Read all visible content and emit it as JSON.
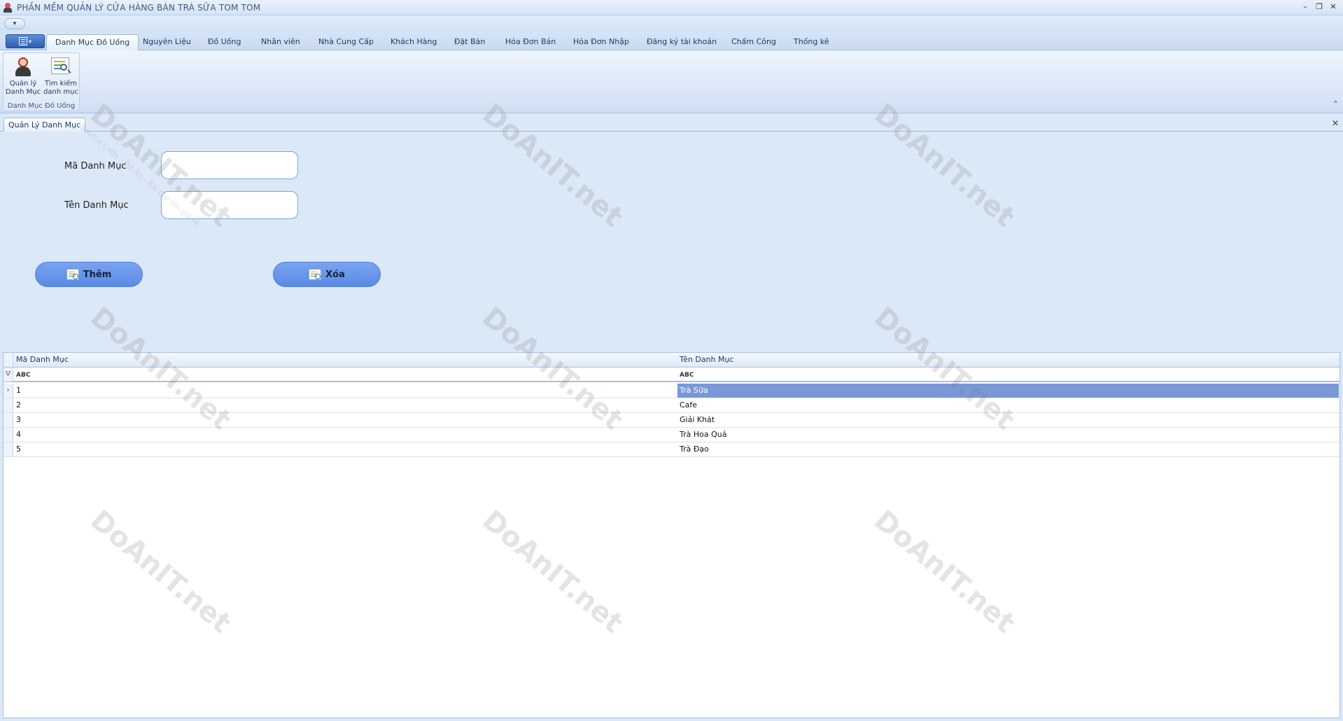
{
  "window": {
    "title": "PHẦN MỀM QUẢN LÝ CỬA HÀNG BÁN TRÀ SỮA TOM TOM",
    "controls": {
      "minimize": "–",
      "restore": "❐",
      "close": "✕"
    }
  },
  "quick_access": {
    "toggle": "▾"
  },
  "ribbon": {
    "tabs": [
      {
        "label": "Danh Mục Đồ Uống",
        "active": true
      },
      {
        "label": "Nguyên Liệu"
      },
      {
        "label": "Đồ Uống"
      },
      {
        "label": "Nhân viên"
      },
      {
        "label": "Nhà Cung Cấp"
      },
      {
        "label": "Khách Hàng"
      },
      {
        "label": "Đặt Bàn"
      },
      {
        "label": "Hóa Đơn Bán"
      },
      {
        "label": "Hóa Đơn Nhập"
      },
      {
        "label": "Đăng ký tài khoản"
      },
      {
        "label": "Chấm Công"
      },
      {
        "label": "Thống kê"
      }
    ],
    "group": {
      "label": "Danh Mục Đồ Uống",
      "buttons": [
        {
          "label": "Quản lý Danh Mục",
          "icon": "person-icon"
        },
        {
          "label": "Tìm kiếm danh mục",
          "icon": "search-list-icon"
        }
      ]
    },
    "collapse": "⌃"
  },
  "document": {
    "tab_label": "Quản Lý Danh Mục",
    "close": "✕"
  },
  "form": {
    "ma_label": "Mã Danh Mục",
    "ma_value": "",
    "ten_label": "Tên Danh Mục",
    "ten_value": "",
    "them_button": "Thêm",
    "xoa_button": "Xóa"
  },
  "grid": {
    "columns": [
      "Mã Danh Mục",
      "Tên Danh Mục"
    ],
    "filter_badge": "ABC",
    "rows": [
      {
        "ma": "1",
        "ten": "Trà Sữa",
        "selected": true
      },
      {
        "ma": "2",
        "ten": "Cafe"
      },
      {
        "ma": "3",
        "ten": "Giải Khát"
      },
      {
        "ma": "4",
        "ten": "Trà Hoa Quả"
      },
      {
        "ma": "5",
        "ten": "Trà Đạo"
      }
    ]
  },
  "watermark": {
    "brand": "DoAnIT.net",
    "tagline": "Source Code - Đồ Án - Bài tập lớn giá rẻ"
  },
  "colors": {
    "ribbon_bg": "#dbe8f8",
    "button_blue": "#6a96ea",
    "selected_row": "#7a97d8"
  }
}
